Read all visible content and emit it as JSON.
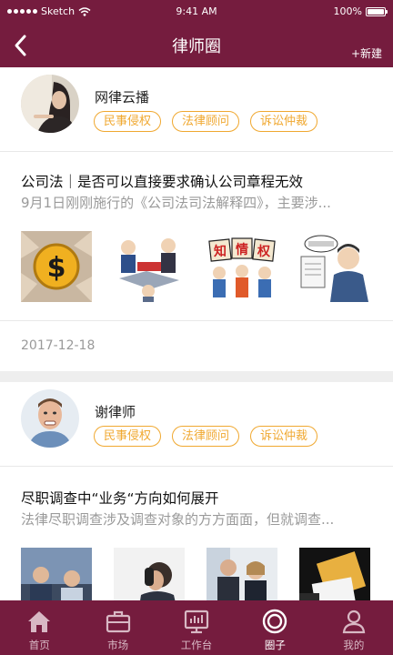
{
  "status_bar": {
    "carrier": "Sketch",
    "time": "9:41 AM",
    "battery_text": "100%",
    "battery_level": 1.0
  },
  "nav": {
    "title": "律师圈",
    "new_label": "+新建"
  },
  "posts": [
    {
      "author_name": "网律云播",
      "tags": [
        "民事侵权",
        "法律顾问",
        "诉讼仲裁"
      ],
      "title": "公司法｜是否可以直接要求确认公司章程无效",
      "summary": "9月1日刚刚施行的《公司法司法解释四》，主要涉...",
      "date": "2017-12-18",
      "thumbnails": [
        "dollar-coin-image",
        "business-cartoon-image",
        "intellectual-property-cartoon-image",
        "lawyer-cartoon-image"
      ]
    },
    {
      "author_name": "谢律师",
      "tags": [
        "民事侵权",
        "法律顾问",
        "诉讼仲裁"
      ],
      "title": "尽职调查中“业务“方向如何展开",
      "summary": "法律尽职调查涉及调查对象的方方面面，但就调查...",
      "thumbnails": [
        "meeting-photo",
        "phone-call-photo",
        "business-people-photo",
        "document-handshake-photo"
      ]
    }
  ],
  "tabbar": {
    "items": [
      {
        "label": "首页",
        "icon": "home-icon"
      },
      {
        "label": "市场",
        "icon": "briefcase-icon"
      },
      {
        "label": "工作台",
        "icon": "dashboard-icon"
      },
      {
        "label": "圈子",
        "icon": "circle-icon"
      },
      {
        "label": "我的",
        "icon": "person-icon"
      }
    ],
    "active_index": 3
  },
  "colors": {
    "brand": "#751c3e",
    "tag": "#f0a830",
    "muted_text": "#9a9a9a"
  }
}
